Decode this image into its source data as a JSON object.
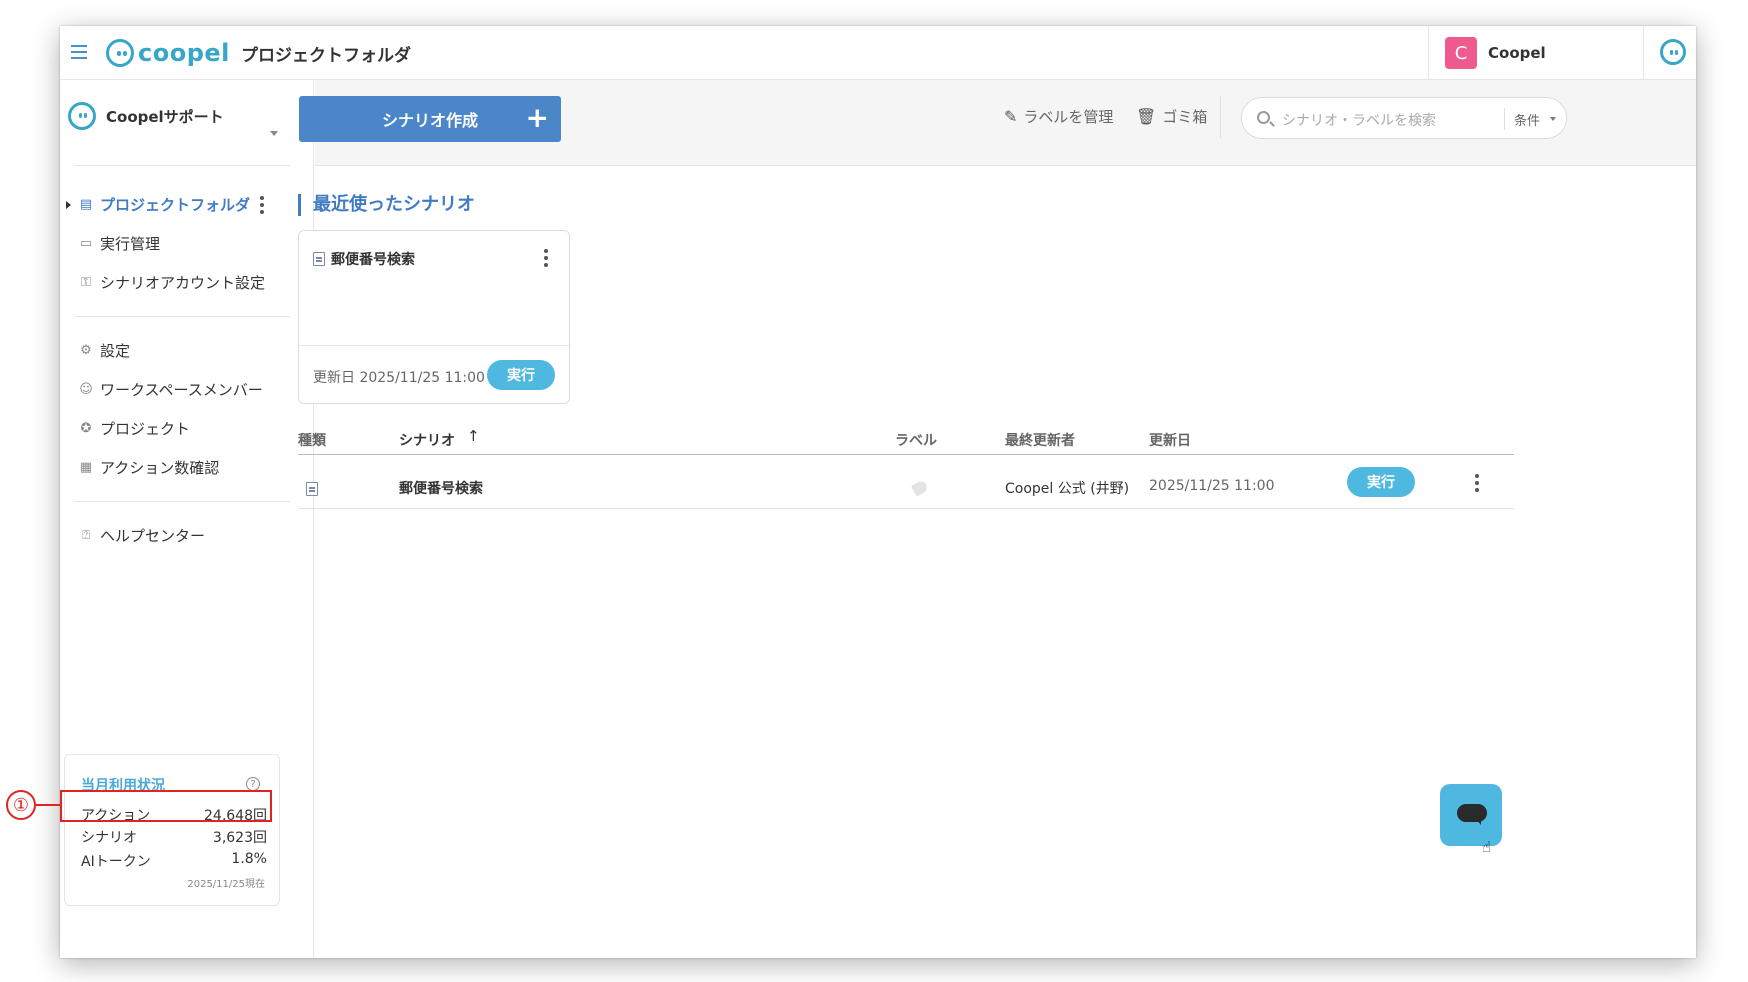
{
  "header": {
    "brand": "coopel",
    "page_title": "プロジェクトフォルダ",
    "user_initial": "C",
    "user_name": "Coopel"
  },
  "sidebar": {
    "workspace": "Coopelサポート",
    "nav": [
      {
        "label": "プロジェクトフォルダ",
        "icon": "folder-list-icon",
        "active": true
      },
      {
        "label": "実行管理",
        "icon": "window-icon"
      },
      {
        "label": "シナリオアカウント設定",
        "icon": "account-lock-icon"
      },
      {
        "label": "設定",
        "icon": "gear-icon"
      },
      {
        "label": "ワークスペースメンバー",
        "icon": "members-icon"
      },
      {
        "label": "プロジェクト",
        "icon": "project-icon"
      },
      {
        "label": "アクション数確認",
        "icon": "chart-icon"
      },
      {
        "label": "ヘルプセンター",
        "icon": "help-icon"
      }
    ],
    "usage": {
      "title": "当月利用状況",
      "help": "?",
      "rows": [
        {
          "label": "アクション",
          "value": "24,648回"
        },
        {
          "label": "シナリオ",
          "value": "3,623回"
        },
        {
          "label": "AIトークン",
          "value": "1.8%"
        }
      ],
      "as_of": "2025/11/25現在"
    }
  },
  "toolbar": {
    "create_label": "シナリオ作成",
    "create_plus": "+",
    "manage_labels": "ラベルを管理",
    "trash": "ゴミ箱",
    "search_placeholder": "シナリオ・ラベルを検索",
    "condition": "条件"
  },
  "recent": {
    "title": "最近使ったシナリオ",
    "card": {
      "name": "郵便番号検索",
      "updated": "更新日 2025/11/25 11:00",
      "run_label": "実行"
    }
  },
  "table": {
    "headers": {
      "type": "種類",
      "scenario": "シナリオ",
      "sort": "↑",
      "label": "ラベル",
      "updater": "最終更新者",
      "updated": "更新日"
    },
    "rows": [
      {
        "name": "郵便番号検索",
        "updater": "Coopel 公式 (井野)",
        "updated": "2025/11/25 11:00",
        "run_label": "実行"
      }
    ]
  },
  "annotation": {
    "marker": "①"
  },
  "colors": {
    "brand": "#36a7c6",
    "primary": "#4a86c8",
    "run": "#4fb8e0",
    "avatar": "#ef5b8e",
    "annotation": "#e02424"
  }
}
